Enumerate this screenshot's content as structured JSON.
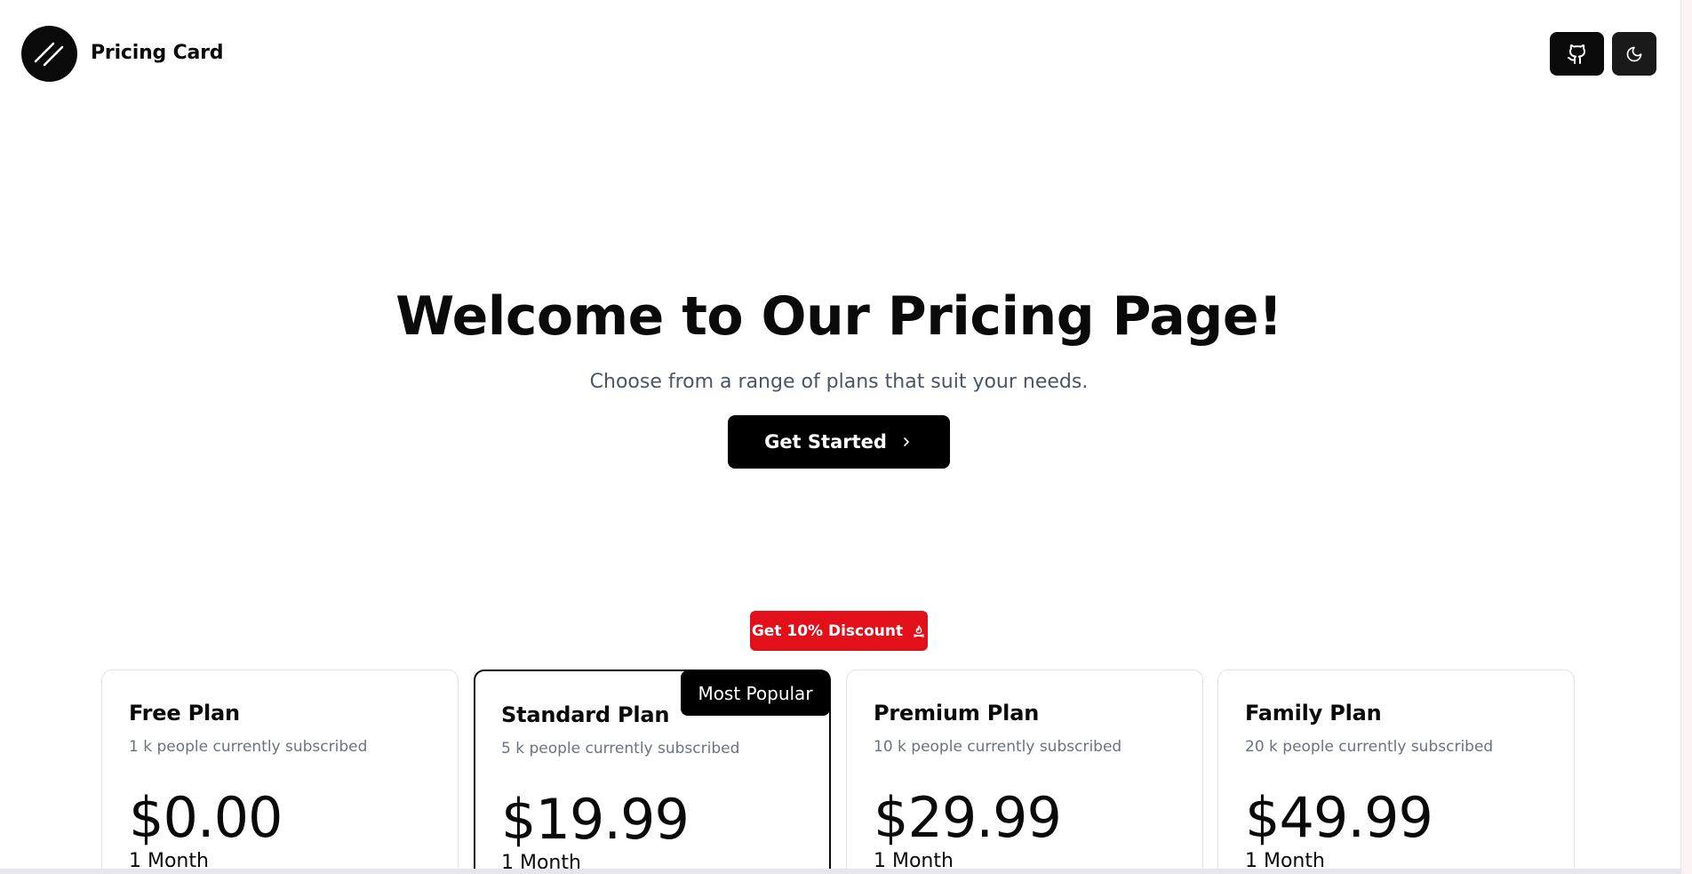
{
  "header": {
    "brand": "Pricing Card",
    "logo_icon": "double-slash-logo-icon",
    "github_icon": "github-icon",
    "theme_icon": "moon-icon"
  },
  "hero": {
    "title": "Welcome to Our Pricing Page!",
    "subtitle": "Choose from a range of plans that suit your needs.",
    "cta_label": "Get Started",
    "cta_icon": "chevron-right-icon"
  },
  "discount": {
    "label": "Get 10% Discount",
    "icon": "flame-icon",
    "color": "#e2101b"
  },
  "plans": [
    {
      "name": "Free Plan",
      "subscribers": "1 k people currently subscribed",
      "price": "$0.00",
      "period": "1 Month",
      "featured": false
    },
    {
      "name": "Standard Plan",
      "subscribers": "5 k people currently subscribed",
      "price": "$19.99",
      "period": "1 Month",
      "featured": true,
      "badge": "Most Popular"
    },
    {
      "name": "Premium Plan",
      "subscribers": "10 k people currently subscribed",
      "price": "$29.99",
      "period": "1 Month",
      "featured": false
    },
    {
      "name": "Family Plan",
      "subscribers": "20 k people currently subscribed",
      "price": "$49.99",
      "period": "1 Month",
      "featured": false
    }
  ],
  "colors": {
    "primary": "#000000",
    "accent_red": "#e2101b",
    "muted_text": "#6b7280"
  }
}
